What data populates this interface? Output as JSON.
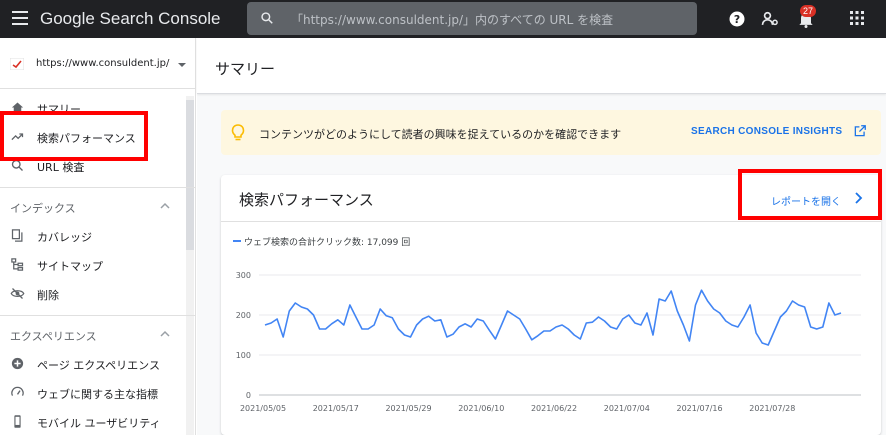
{
  "header": {
    "brand": "Google Search Console",
    "search_placeholder": "「https://www.consuldent.jp/」内のすべての URL を検査",
    "notification_count": "27"
  },
  "sidebar": {
    "property_url": "https://www.consuldent.jp/",
    "items": [
      {
        "label": "サマリー",
        "icon": "home-icon"
      },
      {
        "label": "検索パフォーマンス",
        "icon": "trending-up-icon"
      },
      {
        "label": "URL 検査",
        "icon": "search-icon"
      }
    ],
    "sections": [
      {
        "title": "インデックス",
        "items": [
          {
            "label": "カバレッジ",
            "icon": "file-copy-icon"
          },
          {
            "label": "サイトマップ",
            "icon": "sitemap-icon"
          },
          {
            "label": "削除",
            "icon": "visibility-off-icon"
          }
        ]
      },
      {
        "title": "エクスペリエンス",
        "items": [
          {
            "label": "ページ エクスペリエンス",
            "icon": "add-circle-icon"
          },
          {
            "label": "ウェブに関する主な指標",
            "icon": "speed-icon"
          },
          {
            "label": "モバイル ユーザビリティ",
            "icon": "smartphone-icon"
          }
        ]
      }
    ]
  },
  "main": {
    "title": "サマリー",
    "insights_text": "コンテンツがどのようにして読者の興味を捉えているのかを確認できます",
    "insights_link": "SEARCH CONSOLE INSIGHTS",
    "card_title": "検索パフォーマンス",
    "report_link": "レポートを開く",
    "legend_label": "ウェブ検索の合計クリック数: 17,099 回"
  },
  "colors": {
    "topbar": "#202124",
    "accent": "#1a73e8",
    "highlight": "#ff0000",
    "insights_bg": "#fef7e0",
    "bulb": "#fbbc04"
  },
  "chart_data": {
    "type": "line",
    "title": "",
    "xlabel": "",
    "ylabel": "",
    "ylim": [
      0,
      300
    ],
    "yticks": [
      0,
      100,
      200,
      300
    ],
    "xtick_labels": [
      "2021/05/05",
      "2021/05/17",
      "2021/05/29",
      "2021/06/10",
      "2021/06/22",
      "2021/07/04",
      "2021/07/16",
      "2021/07/28"
    ],
    "start_label_index": 0,
    "series": [
      {
        "name": "ウェブ検索の合計クリック数: 17,099 回",
        "color": "#4285f4",
        "values": [
          175,
          180,
          190,
          145,
          210,
          230,
          220,
          215,
          200,
          165,
          165,
          178,
          188,
          175,
          225,
          195,
          165,
          165,
          175,
          215,
          198,
          193,
          165,
          150,
          145,
          175,
          190,
          197,
          185,
          188,
          145,
          152,
          170,
          178,
          170,
          190,
          185,
          162,
          140,
          175,
          210,
          200,
          190,
          165,
          138,
          148,
          160,
          160,
          170,
          175,
          165,
          150,
          140,
          180,
          182,
          195,
          185,
          170,
          165,
          190,
          200,
          180,
          175,
          205,
          150,
          240,
          235,
          260,
          210,
          175,
          135,
          225,
          262,
          235,
          215,
          205,
          185,
          175,
          170,
          195,
          225,
          155,
          130,
          125,
          160,
          195,
          210,
          235,
          225,
          220,
          170,
          165,
          170,
          230,
          200,
          205
        ]
      }
    ]
  }
}
